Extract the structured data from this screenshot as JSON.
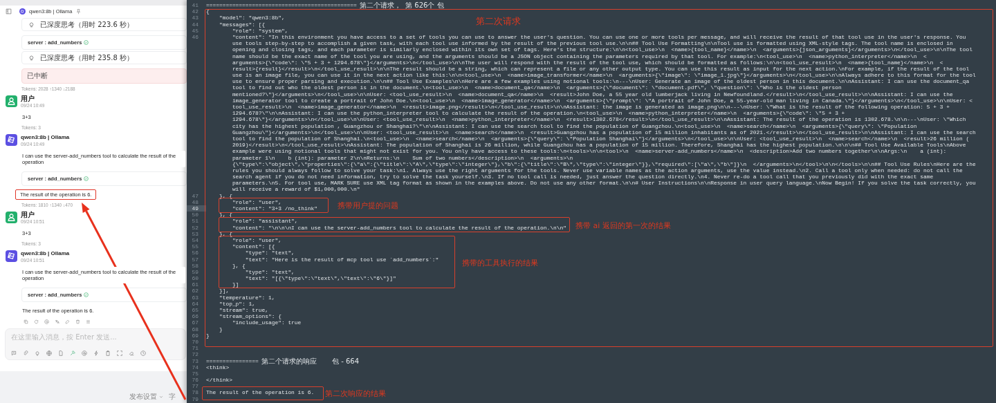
{
  "chat": {
    "blocks": [
      {
        "kind": "header",
        "text": "qwen3:8b | Ollama"
      },
      {
        "kind": "thinking",
        "text": "已深度思考（用时 223.6 秒）"
      },
      {
        "kind": "tool",
        "text": "server : add_numbers"
      },
      {
        "kind": "thinking",
        "text": "已深度思考（用时 235.8 秒）"
      },
      {
        "kind": "interrupted",
        "text": "已中断"
      },
      {
        "kind": "meta",
        "text": "Tokens: 2028 ↑1340 ↓2188"
      },
      {
        "kind": "user",
        "name": "用户",
        "time": "09/24 10:49"
      },
      {
        "kind": "text",
        "text": "3+3",
        "marked": false
      },
      {
        "kind": "meta",
        "text": "Tokens: 3"
      },
      {
        "kind": "assistant",
        "name": "qwen3:8b | Ollama",
        "time": "09/24 10:49"
      },
      {
        "kind": "text",
        "text": "I can use the server-add_numbers tool to calculate the result of the operation",
        "marked": false
      },
      {
        "kind": "tool",
        "text": "server : add_numbers"
      },
      {
        "kind": "text",
        "text": "The result of the operation is 6.",
        "marked": true
      },
      {
        "kind": "meta",
        "text": "Tokens: 1810 ↑1340 ↓470"
      },
      {
        "kind": "user",
        "name": "用户",
        "time": "09/24 10:51"
      },
      {
        "kind": "text",
        "text": "3+3",
        "marked": false
      },
      {
        "kind": "meta",
        "text": "Tokens: 3"
      },
      {
        "kind": "assistant",
        "name": "qwen3:8b | Ollama",
        "time": "09/24 10:51"
      },
      {
        "kind": "text",
        "text": "I can use the server-add_numbers tool to calculate the result of the operation",
        "marked": false
      },
      {
        "kind": "tool",
        "text": "server : add_numbers"
      },
      {
        "kind": "text",
        "text": "The result of the operation is 6.",
        "marked": false
      },
      {
        "kind": "actions"
      }
    ],
    "input": {
      "placeholder": "在这里输入消息，按 Enter 发送..."
    }
  },
  "footer": {
    "settings": "发布设置",
    "cut_label": "字"
  },
  "editor": {
    "lines": [
      {
        "number": "41",
        "text": "==============================================",
        "note": "第二个请求，  第 626个 包",
        "current": false
      },
      {
        "number": "42",
        "text": "{",
        "current": false
      },
      {
        "number": "43",
        "text": "    \"model\": \"qwen3:8b\",",
        "current": false
      },
      {
        "number": "44",
        "text": "    \"messages\": [{",
        "current": false
      },
      {
        "number": "45",
        "text": "        \"role\": \"system\",",
        "current": false
      },
      {
        "number": "46",
        "text": "        \"content\": \"In this environment you have access to a set of tools you can use to answer the user's question. You can use one or more tools per message, and will receive the result of that tool use in the user's response. You",
        "current": false
      },
      {
        "text": "        use tools step-by-step to accomplish a given task, with each tool use informed by the result of the previous tool use.\\n\\n## Tool Use Formatting\\n\\nTool use is formatted using XML-style tags. The tool name is enclosed in",
        "current": false
      },
      {
        "text": "        opening and closing tags, and each parameter is similarly enclosed within its own set of tags. Here's the structure:\\n\\n<tool_use>\\n  <name>{tool_name}</name>\\n  <arguments>{json_arguments}</arguments>\\n</tool_use>\\n\\nThe tool",
        "current": false
      },
      {
        "text": "        name should be the exact name of the tool you are using, and the arguments should be a JSON object containing the parameters required by that tool. For example:\\n<tool_use>\\n  <name>python_interpreter</name>\\n  <",
        "current": false
      },
      {
        "text": "        arguments>{\\\"code\\\": \\\"5 + 3 + 1294.678\\\"}</arguments>\\n</tool_use>\\n\\nThe user will respond with the result of the tool use, which should be formatted as follows:\\n\\n<tool_use_result>\\n  <name>{tool_name}</name>\\n  <",
        "current": false
      },
      {
        "text": "        result>{result}</result>\\n</tool_use_result>\\n\\nThe result should be a string, which can represent a file or any other output type. You can use this result as input for the next action.\\nFor example, if the result of the tool",
        "current": false
      },
      {
        "text": "        use is an image file, you can use it in the next action like this:\\n\\n<tool_use>\\n  <name>image_transformer</name>\\n  <arguments>{\\\"image\\\": \\\"image_1.jpg\\\"}</arguments>\\n</tool_use>\\n\\nAlways adhere to this format for the tool",
        "current": false
      },
      {
        "text": "        use to ensure proper parsing and execution.\\n\\n## Tool Use Examples\\n\\nHere are a few examples using notional tools:\\n---\\nUser: Generate an image of the oldest person in this document.\\n\\nAssistant: I can use the document_qa",
        "current": false
      },
      {
        "text": "        tool to find out who the oldest person is in the document.\\n<tool_use>\\n  <name>document_qa</name>\\n  <arguments>{\\\"document\\\": \\\"document.pdf\\\", \\\"question\\\": \\\"Who is the oldest person",
        "current": false
      },
      {
        "text": "        mentioned?\\\"}</arguments>\\n</tool_use>\\n\\nUser: <tool_use_result>\\n  <name>document_qa</name>\\n  <result>John Doe, a 55 year old lumberjack living in Newfoundland.</result>\\n</tool_use_result>\\n\\nAssistant: I can use the",
        "current": false
      },
      {
        "text": "        image_generator tool to create a portrait of John Doe.\\n<tool_use>\\n  <name>image_generator</name>\\n  <arguments>{\\\"prompt\\\": \\\"A portrait of John Doe, a 55-year-old man living in Canada.\\\"}</arguments>\\n</tool_use>\\n\\nUser: <",
        "current": false
      },
      {
        "text": "        tool_use_result>\\n  <name>image_generator</name>\\n  <result>image.png</result>\\n</tool_use_result>\\n\\nAssistant: the image is generated as image.png\\n\\n---\\nUser: \\\"What is the result of the following operation: 5 + 3 +",
        "current": false
      },
      {
        "text": "        1294.678?\\\"\\n\\nAssistant: I can use the python_interpreter tool to calculate the result of the operation.\\n<tool_use>\\n  <name>python_interpreter</name>\\n  <arguments>{\\\"code\\\": \\\"5 + 3 +",
        "current": false
      },
      {
        "text": "        1294.678\\\"}</arguments>\\n</tool_use>\\n\\nUser: <tool_use_result>\\n  <name>python_interpreter</name>\\n  <result>1302.678</result>\\n</tool_use_result>\\n\\nAssistant: The result of the operation is 1302.678.\\n\\n---\\nUser: \\\"Which",
        "current": false
      },
      {
        "text": "        city has the highest population , Guangzhou or Shanghai?\\\"\\n\\nAssistant: I can use the search tool to find the population of Guangzhou.\\n<tool_use>\\n  <name>search</name>\\n  <arguments>{\\\"query\\\": \\\"Population",
        "current": false
      },
      {
        "text": "        Guangzhou\\\"}</arguments>\\n</tool_use>\\n\\nUser: <tool_use_result>\\n  <name>search</name>\\n  <result>Guangzhou has a population of 15 million inhabitants as of 2021.</result>\\n</tool_use_result>\\n\\nAssistant: I can use the search",
        "current": false
      },
      {
        "text": "        tool to find the population of Shanghai.\\n<tool_use>\\n  <name>search</name>\\n  <arguments>{\\\"query\\\": \\\"Population Shanghai\\\"}</arguments>\\n</tool_use>\\n\\nUser: <tool_use_result>\\n  <name>search</name>\\n  <result>26 million (",
        "current": false
      },
      {
        "text": "        2019)</result>\\n</tool_use_result>\\nAssistant: The population of Shanghai is 26 million, while Guangzhou has a population of 15 million. Therefore, Shanghai has the highest population.\\n\\n\\n## Tool Use Available Tools\\nAbove",
        "current": false
      },
      {
        "text": "        example were using notional tools that might not exist for you. You only have access to these tools:\\n<tools>\\n\\n<tool>\\n  <name>server-add_numbers</name>\\n  <description>Add two numbers together\\n\\nArgs:\\n    a (int):",
        "current": false
      },
      {
        "text": "        parameter 1\\n    b (int): parameter 2\\n\\nReturns:\\n    Sum of two numbers</description>\\n  <arguments>\\n",
        "current": false
      },
      {
        "text": "        {\\\"type\\\":\\\"object\\\",\\\"properties\\\":{\\\"a\\\":{\\\"title\\\":\\\"A\\\",\\\"type\\\":\\\"integer\\\"},\\\"b\\\":{\\\"title\\\":\\\"B\\\",\\\"type\\\":\\\"integer\\\"}},\\\"required\\\":[\\\"a\\\",\\\"b\\\"]}\\n  </arguments>\\n</tool>\\n\\n</tools>\\n\\n## Tool Use Rules\\nHere are the",
        "current": false
      },
      {
        "text": "        rules you should always follow to solve your task:\\n1. Always use the right arguments for the tools. Never use variable names as the action arguments, use the value instead.\\n2. Call a tool only when needed: do not call the",
        "current": false
      },
      {
        "text": "        search agent if you do not need information, try to solve the task yourself.\\n3. If no tool call is needed, just answer the question directly.\\n4. Never re-do a tool call that you previously did with the exact same",
        "current": false
      },
      {
        "text": "        parameters.\\n5. For tool use, MARK SURE use XML tag format as shown in the examples above. Do not use any other format.\\n\\n# User Instructions\\n\\nResponse in user query language.\\nNow Begin! If you solve the task correctly, you",
        "current": false
      },
      {
        "text": "        will receive a reward of $1,000,000.\\n\"",
        "current": false
      },
      {
        "number": "47",
        "text": "    }, {",
        "current": false
      },
      {
        "number": "48",
        "text": "        \"role\": \"user\",",
        "current": false
      },
      {
        "number": "49",
        "text": "        \"content\": \"3+3 /no_think\"",
        "current": true
      },
      {
        "number": "50",
        "text": "    }, {",
        "current": false
      },
      {
        "number": "51",
        "text": "        \"role\": \"assistant\",",
        "current": false
      },
      {
        "number": "52",
        "text": "        \"content\": \"\\n\\n\\nI can use the server-add_numbers tool to calculate the result of the operation.\\n\\n\"",
        "current": false
      },
      {
        "number": "53",
        "text": "    }, {",
        "current": false
      },
      {
        "number": "54",
        "text": "        \"role\": \"user\",",
        "current": false
      },
      {
        "number": "55",
        "text": "        \"content\": [{",
        "current": false
      },
      {
        "number": "56",
        "text": "            \"type\": \"text\",",
        "current": false
      },
      {
        "number": "57",
        "text": "            \"text\": \"Here is the result of mcp tool use `add_numbers`:\"",
        "current": false
      },
      {
        "number": "58",
        "text": "        }, {",
        "current": false
      },
      {
        "number": "59",
        "text": "            \"type\": \"text\",",
        "current": false
      },
      {
        "number": "60",
        "text": "            \"text\": \"[{\\\"type\\\":\\\"text\\\",\\\"text\\\":\\\"6\\\"}]\"",
        "current": false
      },
      {
        "number": "61",
        "text": "        }]",
        "current": false
      },
      {
        "number": "62",
        "text": "    }],",
        "current": false
      },
      {
        "number": "63",
        "text": "    \"temperature\": 1,",
        "current": false
      },
      {
        "number": "64",
        "text": "    \"top_p\": 1,",
        "current": false
      },
      {
        "number": "65",
        "text": "    \"stream\": true,",
        "current": false
      },
      {
        "number": "66",
        "text": "    \"stream_options\": {",
        "current": false
      },
      {
        "number": "67",
        "text": "        \"include_usage\": true",
        "current": false
      },
      {
        "number": "68",
        "text": "    }",
        "current": false
      },
      {
        "number": "69",
        "text": "}",
        "current": false
      },
      {
        "number": "70",
        "current": false
      },
      {
        "number": "71",
        "current": false
      },
      {
        "number": "72",
        "current": false
      },
      {
        "number": "73",
        "text": "================",
        "note": "第二个请求的响应       包 - 664",
        "current": false
      },
      {
        "number": "74",
        "text": "<think>",
        "current": false
      },
      {
        "number": "75",
        "current": false
      },
      {
        "number": "76",
        "text": "</think>",
        "current": false
      },
      {
        "number": "77",
        "current": false
      },
      {
        "number": "78",
        "text": "The result of the operation is 6.",
        "current": false
      },
      {
        "number": "79",
        "current": false
      }
    ],
    "annotations": [
      {
        "label": "第二次请求"
      },
      {
        "label": "携带用户提的问题"
      },
      {
        "label": "携带 ai 返回的第一次的结果"
      },
      {
        "label": "携带的工具执行的结果"
      },
      {
        "label": "第二次响应的结果"
      }
    ]
  }
}
